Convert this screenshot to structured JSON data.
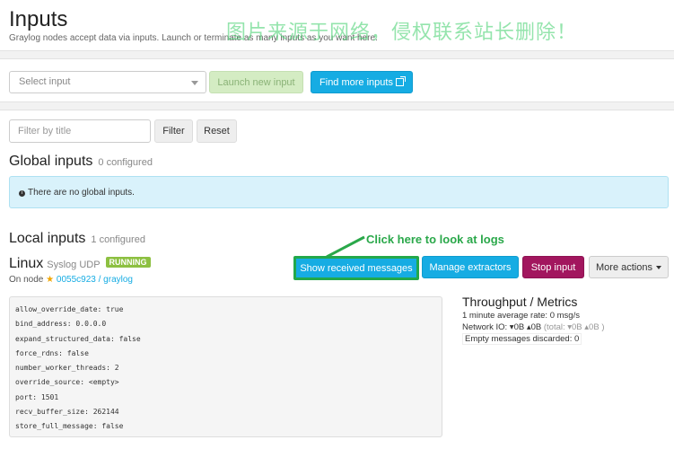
{
  "header": {
    "title": "Inputs",
    "subtitle": "Graylog nodes accept data via inputs. Launch or terminate as many inputs as you want here.",
    "watermark": "图片来源于网络，侵权联系站长删除！"
  },
  "launch": {
    "select_placeholder": "Select input",
    "launch_label": "Launch new input",
    "find_label": "Find more inputs"
  },
  "filter": {
    "placeholder": "Filter by title",
    "filter_label": "Filter",
    "reset_label": "Reset"
  },
  "global": {
    "title": "Global inputs",
    "count": "0 configured",
    "empty_message": "There are no global inputs."
  },
  "local": {
    "title": "Local inputs",
    "count": "1 configured"
  },
  "input": {
    "name": "Linux",
    "type": "Syslog UDP",
    "status": "RUNNING",
    "node_prefix": "On node",
    "node_id": "0055c923 / graylog",
    "config": [
      "allow_override_date: true",
      "bind_address: 0.0.0.0",
      "expand_structured_data: false",
      "force_rdns: false",
      "number_worker_threads: 2",
      "override_source: <empty>",
      "port: 1501",
      "recv_buffer_size: 262144",
      "store_full_message: false"
    ]
  },
  "actions": {
    "show_messages": "Show received messages",
    "manage_extractors": "Manage extractors",
    "stop": "Stop input",
    "more": "More actions"
  },
  "annotation": {
    "text": "Click here to look at logs",
    "color": "#2aa84a"
  },
  "metrics": {
    "title": "Throughput / Metrics",
    "rate": "1 minute average rate: 0 msg/s",
    "network_label": "Network IO:",
    "network_value": "▾0B ▴0B",
    "network_total": "(total: ▾0B ▴0B )",
    "discarded": "Empty messages discarded: 0"
  },
  "colors": {
    "primary": "#16ace3",
    "success": "#8dc041",
    "danger": "#a2165e"
  }
}
